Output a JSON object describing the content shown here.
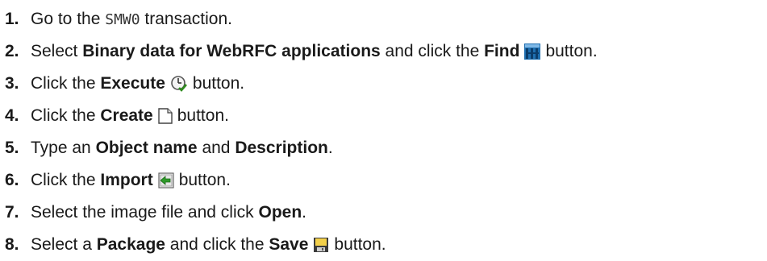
{
  "steps": [
    {
      "num": "1.",
      "pre": "Go to the ",
      "code": "SMW0",
      "post": " transaction."
    },
    {
      "num": "2.",
      "pre": "Select ",
      "b1": "Binary data for WebRFC applications",
      "mid": " and click the ",
      "b2": "Find",
      "icon": "find-icon",
      "post": "button."
    },
    {
      "num": "3.",
      "pre": "Click the ",
      "b1": "Execute",
      "icon": "execute-icon",
      "post": "button."
    },
    {
      "num": "4.",
      "pre": "Click the ",
      "b1": "Create",
      "icon": "create-icon",
      "post": "button."
    },
    {
      "num": "5.",
      "pre": "Type an ",
      "b1": "Object name",
      "mid": " and ",
      "b2": "Description",
      "post": "."
    },
    {
      "num": "6.",
      "pre": "Click the ",
      "b1": "Import",
      "icon": "import-icon",
      "post": "button."
    },
    {
      "num": "7.",
      "pre": "Select the image file and click ",
      "b1": "Open",
      "post": "."
    },
    {
      "num": "8.",
      "pre": "Select a ",
      "b1": "Package",
      "mid": " and click the ",
      "b2": "Save",
      "icon": "save-icon",
      "post": "button."
    }
  ]
}
